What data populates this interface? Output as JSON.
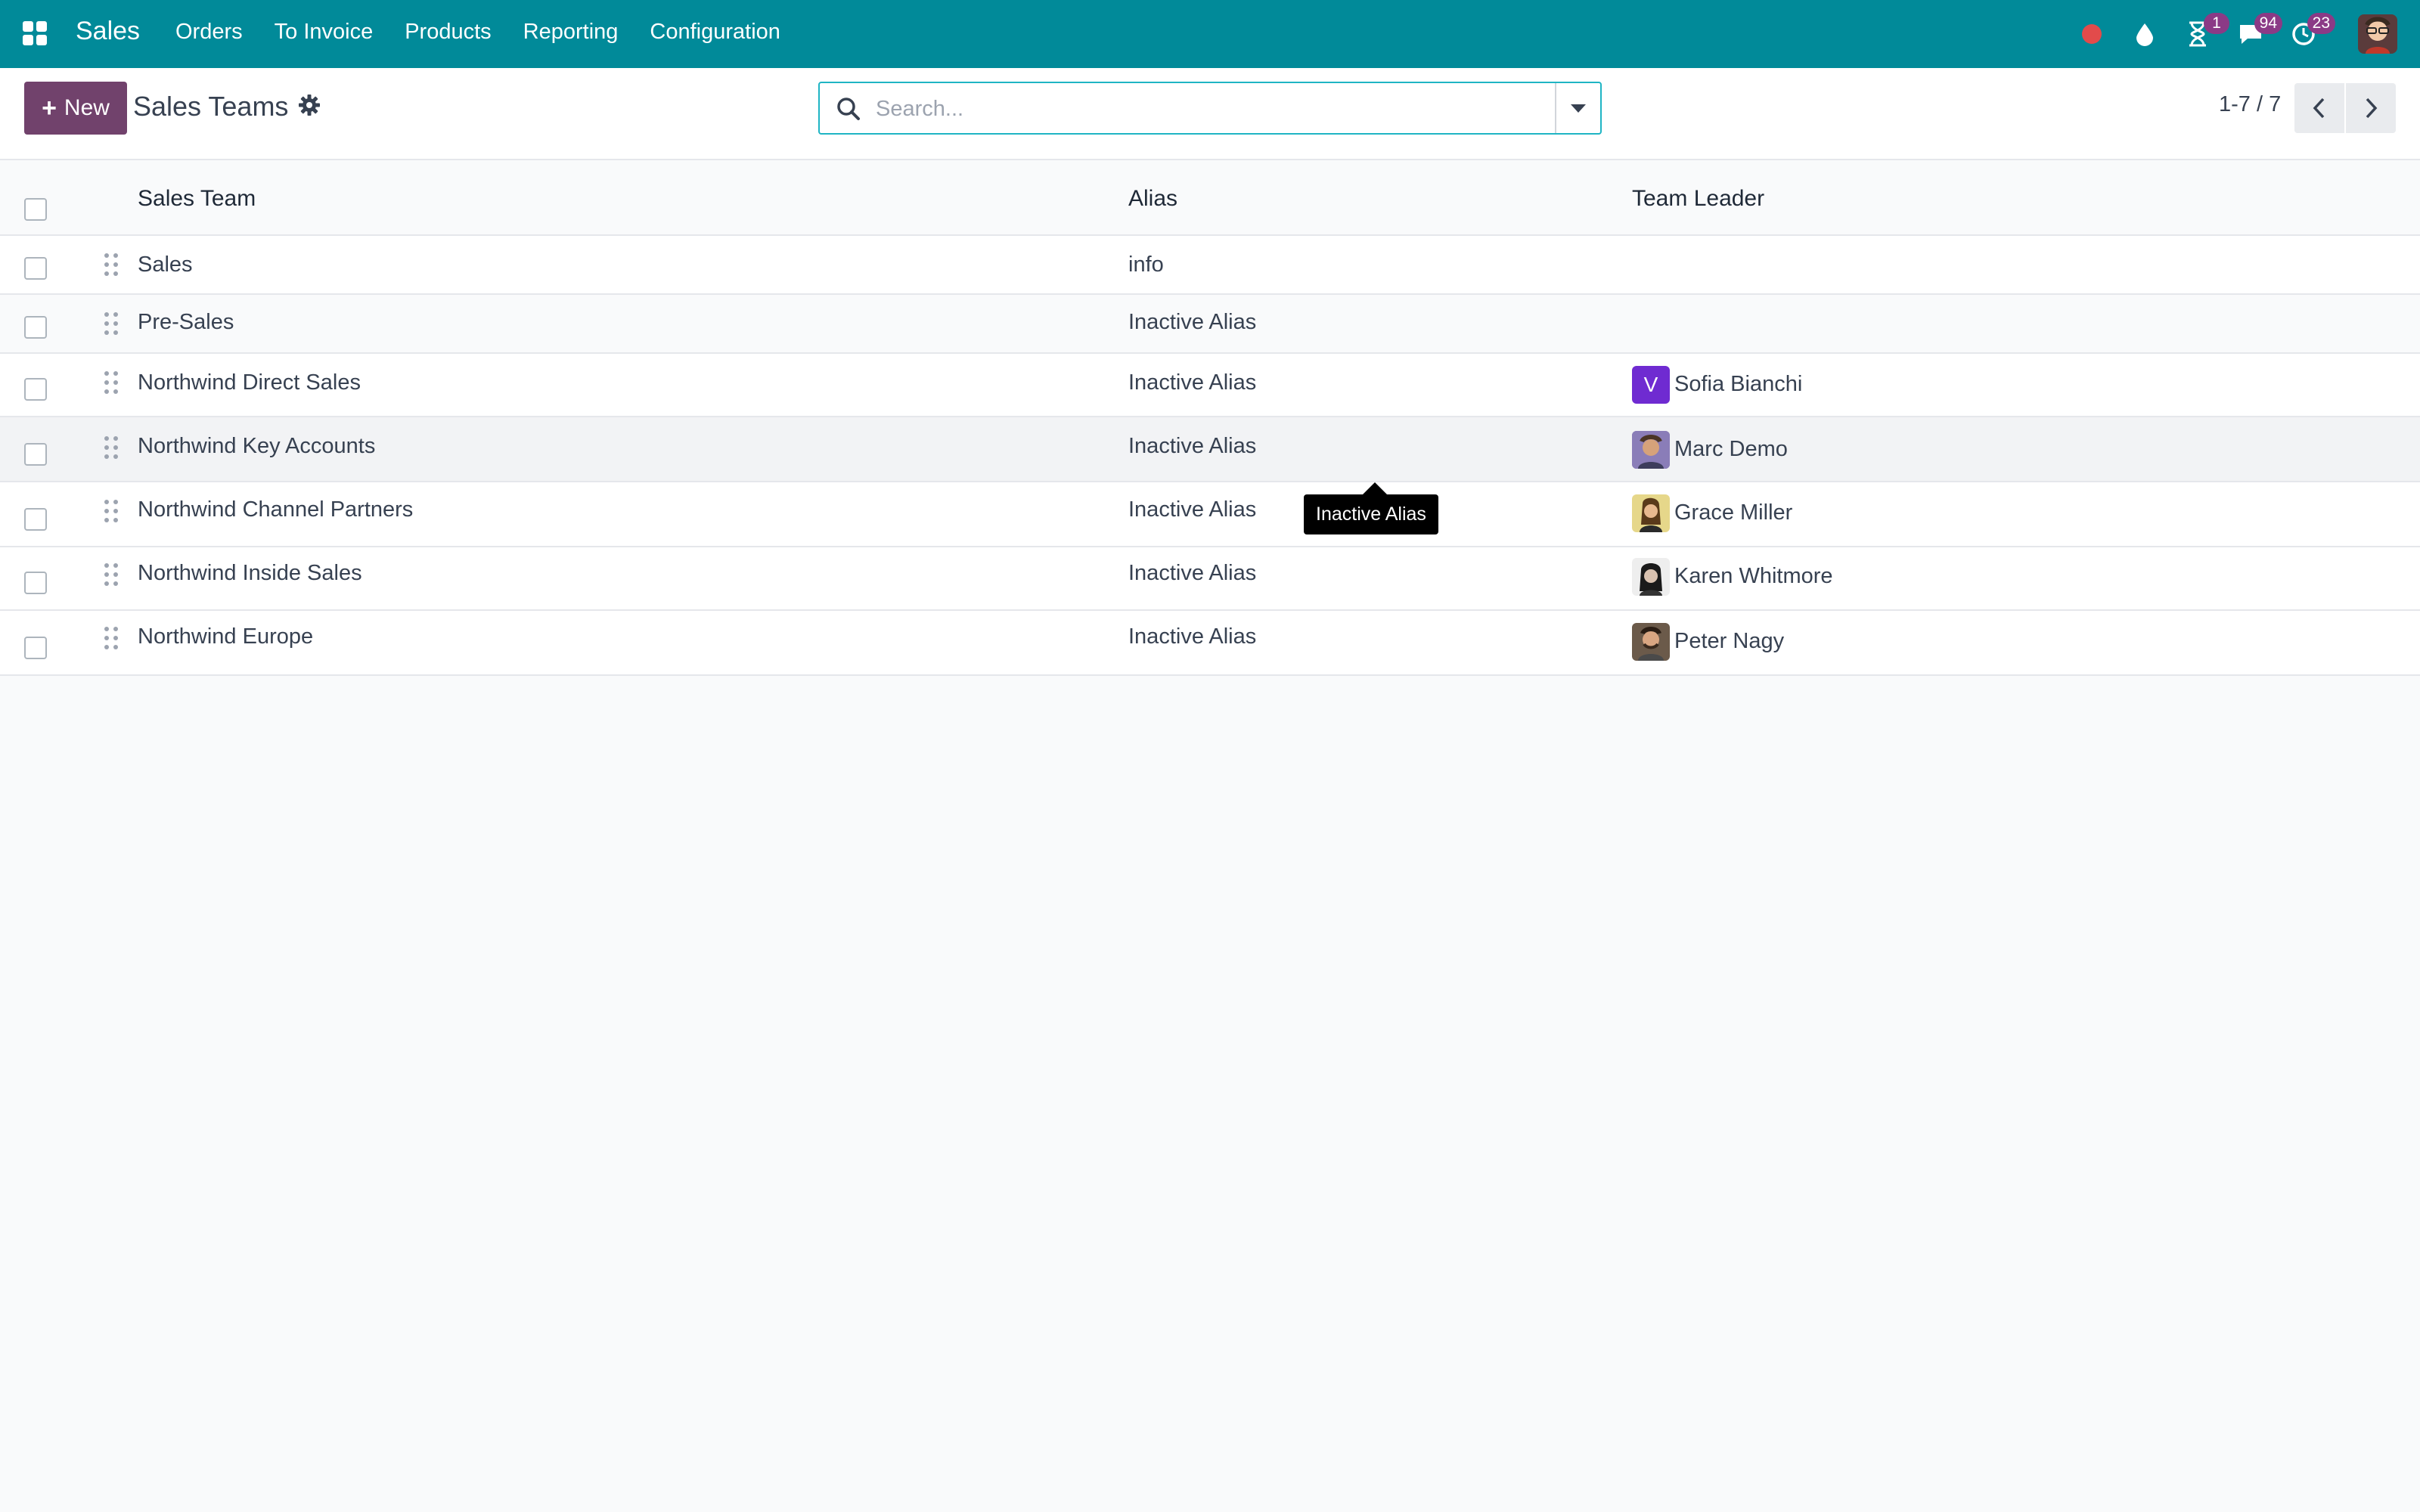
{
  "navbar": {
    "app_name": "Sales",
    "menu": [
      "Orders",
      "To Invoice",
      "Products",
      "Reporting",
      "Configuration"
    ],
    "systray": {
      "recording_color": "#e24b4b",
      "activities_count": "1",
      "messages_count": "94",
      "timer_count": "23"
    },
    "bg_color": "#018a99"
  },
  "control_panel": {
    "new_label": "New",
    "title": "Sales Teams",
    "search_placeholder": "Search...",
    "pager": "1-7 / 7"
  },
  "list": {
    "columns": [
      "Sales Team",
      "Alias",
      "Team Leader"
    ],
    "rows": [
      {
        "team": "Sales",
        "alias": "info",
        "leader": ""
      },
      {
        "team": "Pre-Sales",
        "alias": "Inactive Alias",
        "leader": ""
      },
      {
        "team": "Northwind Direct Sales",
        "alias": "Inactive Alias",
        "leader": "Sofia Bianchi",
        "leader_initial": "V"
      },
      {
        "team": "Northwind Key Accounts",
        "alias": "Inactive Alias",
        "leader": "Marc Demo"
      },
      {
        "team": "Northwind Channel Partners",
        "alias": "Inactive Alias",
        "leader": "Grace Miller"
      },
      {
        "team": "Northwind Inside Sales",
        "alias": "Inactive Alias",
        "leader": "Karen Whitmore"
      },
      {
        "team": "Northwind Europe",
        "alias": "Inactive Alias",
        "leader": "Peter Nagy"
      }
    ]
  },
  "tooltip": {
    "text": "Inactive Alias"
  },
  "accent": "#71426c"
}
